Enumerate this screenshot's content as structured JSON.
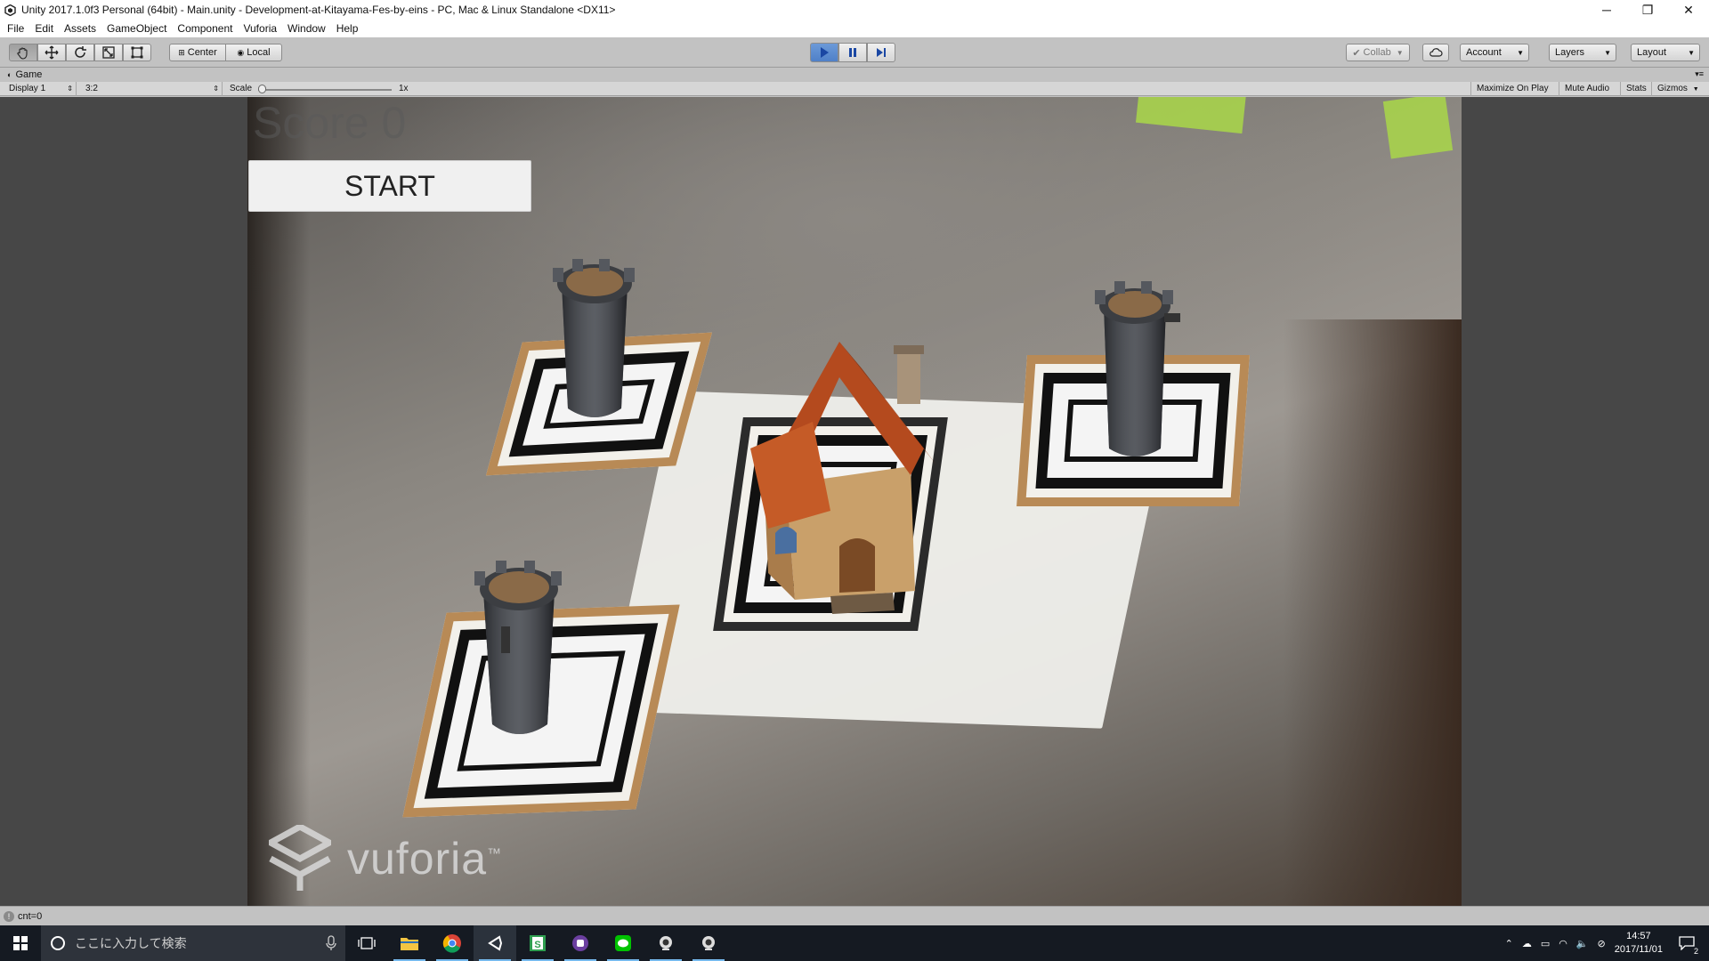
{
  "window": {
    "title": "Unity 2017.1.0f3 Personal (64bit) - Main.unity - Development-at-Kitayama-Fes-by-eins - PC, Mac & Linux Standalone <DX11>",
    "minimize": "─",
    "restore": "❐",
    "close": "✕"
  },
  "menu": [
    "File",
    "Edit",
    "Assets",
    "GameObject",
    "Component",
    "Vuforia",
    "Window",
    "Help"
  ],
  "toolbar": {
    "pivot_label": "Center",
    "space_label": "Local",
    "collab_label": "Collab",
    "account_label": "Account",
    "layers_label": "Layers",
    "layout_label": "Layout"
  },
  "game_tab": {
    "label": "Game"
  },
  "game_bar": {
    "display": "Display 1",
    "aspect": "3:2",
    "scale_label": "Scale",
    "scale_value": "1x",
    "maximize_on_play": "Maximize On Play",
    "mute_audio": "Mute Audio",
    "stats": "Stats",
    "gizmos": "Gizmos"
  },
  "game": {
    "score_text": "Score 0",
    "start_label": "START",
    "vuforia_word": "vuforia",
    "vuforia_tm": "™"
  },
  "status": {
    "message": "cnt=0"
  },
  "taskbar": {
    "search_placeholder": "ここに入力して検索",
    "time": "14:57",
    "date": "2017/11/01",
    "notification_count": "2"
  },
  "colors": {
    "editor_gray": "#c2c2c2",
    "play_blue": "#4f80c8",
    "taskbar": "#151a22",
    "marker_border": "#b88a56"
  }
}
